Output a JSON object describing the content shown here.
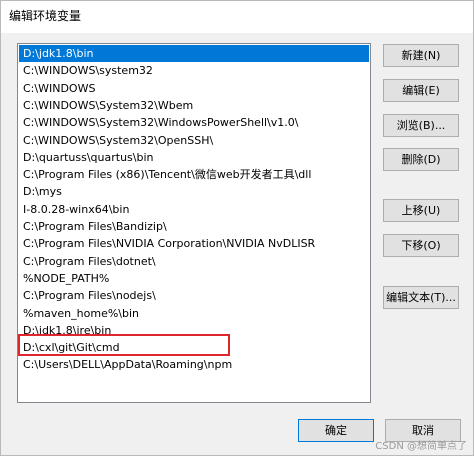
{
  "window": {
    "title": "编辑环境变量"
  },
  "list": {
    "items": [
      "D:\\jdk1.8\\bin",
      "C:\\WINDOWS\\system32",
      "C:\\WINDOWS",
      "C:\\WINDOWS\\System32\\Wbem",
      "C:\\WINDOWS\\System32\\WindowsPowerShell\\v1.0\\",
      "C:\\WINDOWS\\System32\\OpenSSH\\",
      "D:\\quartuss\\quartus\\bin",
      "C:\\Program Files (x86)\\Tencent\\微信web开发者工具\\dll",
      "D:\\mys",
      "I-8.0.28-winx64\\bin",
      "C:\\Program Files\\Bandizip\\",
      "C:\\Program Files\\NVIDIA Corporation\\NVIDIA NvDLISR",
      "C:\\Program Files\\dotnet\\",
      "%NODE_PATH%",
      "C:\\Program Files\\nodejs\\",
      "%maven_home%\\bin",
      "D:\\jdk1.8\\jre\\bin",
      "D:\\cxl\\git\\Git\\cmd",
      "C:\\Users\\DELL\\AppData\\Roaming\\npm"
    ],
    "selected_index": 0,
    "highlighted_index": 18,
    "highlight_color": "#e0252b",
    "selection_color": "#0078d7"
  },
  "buttons": {
    "new": "新建(N)",
    "edit": "编辑(E)",
    "browse": "浏览(B)...",
    "delete": "删除(D)",
    "move_up": "上移(U)",
    "move_down": "下移(O)",
    "edit_text": "编辑文本(T)...",
    "ok": "确定",
    "cancel": "取消"
  },
  "watermark": "CSDN @想简单点了"
}
